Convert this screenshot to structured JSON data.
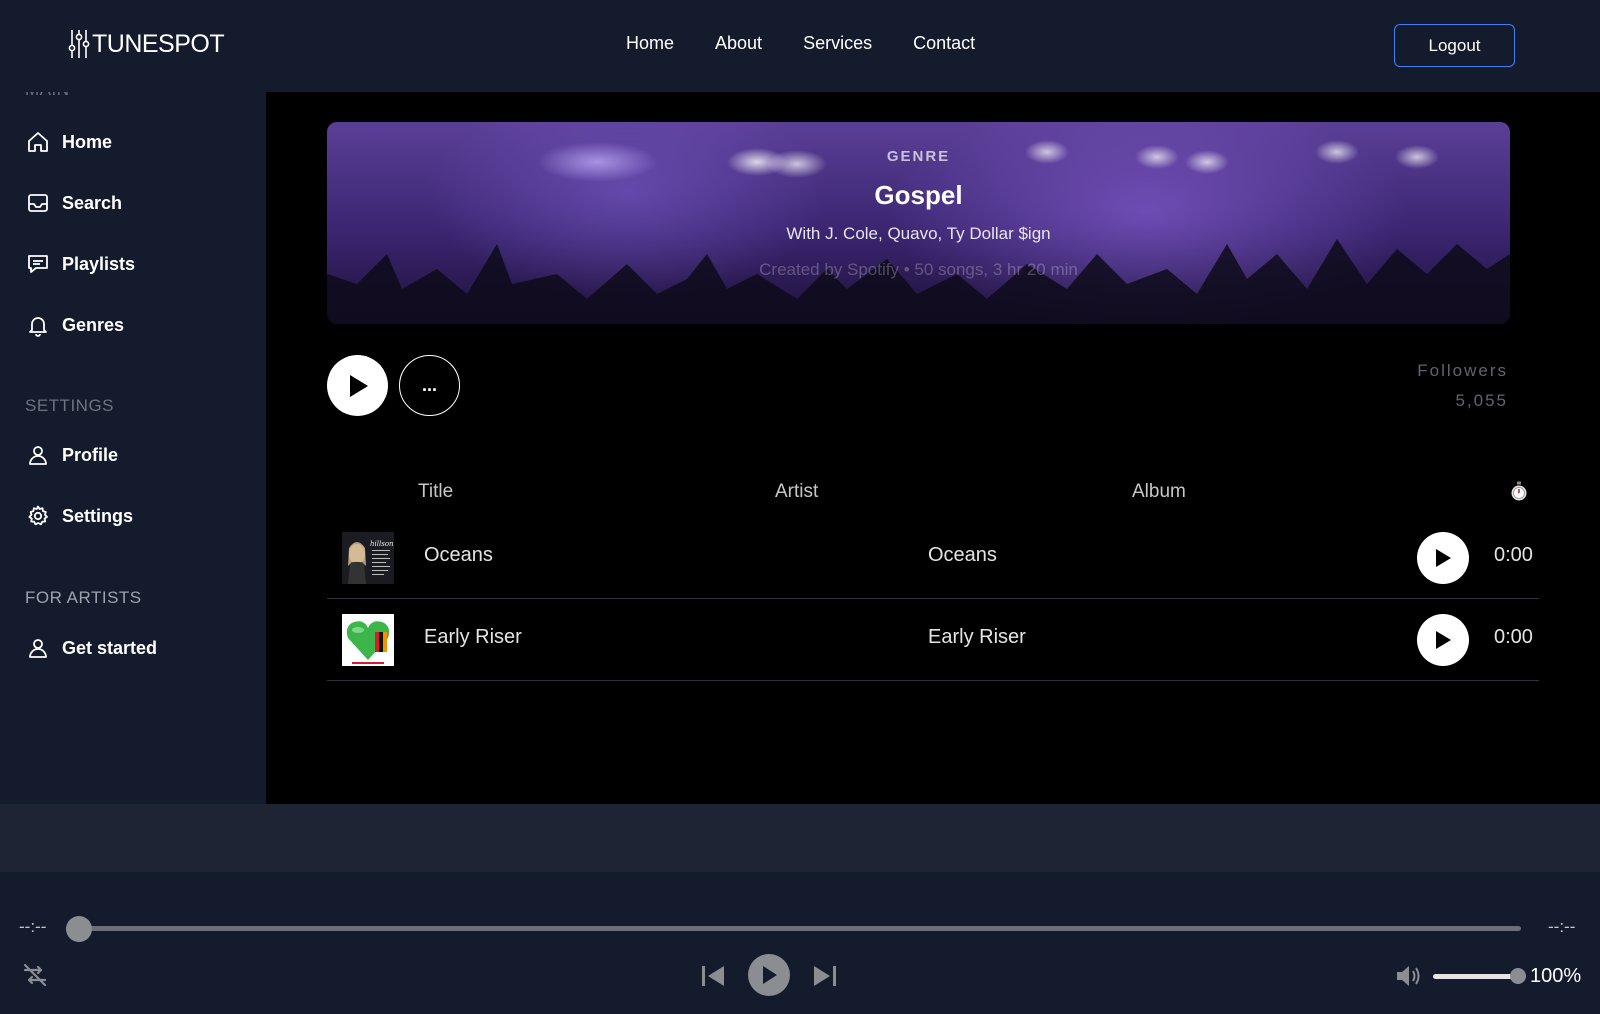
{
  "brand": {
    "name": "TUNESPOT"
  },
  "nav": {
    "links": [
      "Home",
      "About",
      "Services",
      "Contact"
    ],
    "logout_label": "Logout"
  },
  "sidebar": {
    "main_label": "MAIN",
    "main_items": [
      "Home",
      "Search",
      "Playlists",
      "Genres"
    ],
    "settings_label": "SETTINGS",
    "settings_items": [
      "Profile",
      "Settings"
    ],
    "artists_label": "FOR ARTISTS",
    "artists_items": [
      "Get started"
    ]
  },
  "banner": {
    "kicker": "GENRE",
    "title": "Gospel",
    "with_line": "With J. Cole, Quavo, Ty Dollar $ign",
    "created_line": "Created by Spotify • 50 songs, 3 hr 20 min"
  },
  "actions": {
    "more_label": "..."
  },
  "followers": {
    "label": "Followers",
    "count": "5,055"
  },
  "table": {
    "headers": {
      "title": "Title",
      "artist": "Artist",
      "album": "Album"
    },
    "rows": [
      {
        "title": "Oceans",
        "album": "Oceans",
        "duration": "0:00"
      },
      {
        "title": "Early Riser",
        "album": "Early Riser",
        "duration": "0:00"
      }
    ]
  },
  "player": {
    "elapsed": "--:--",
    "remaining": "--:--",
    "progress": 0,
    "volume_label": "100%",
    "volume": 1.0
  },
  "colors": {
    "nav_bg": "#141b2d",
    "accent": "#3b82f6",
    "main_bg": "#000000"
  }
}
